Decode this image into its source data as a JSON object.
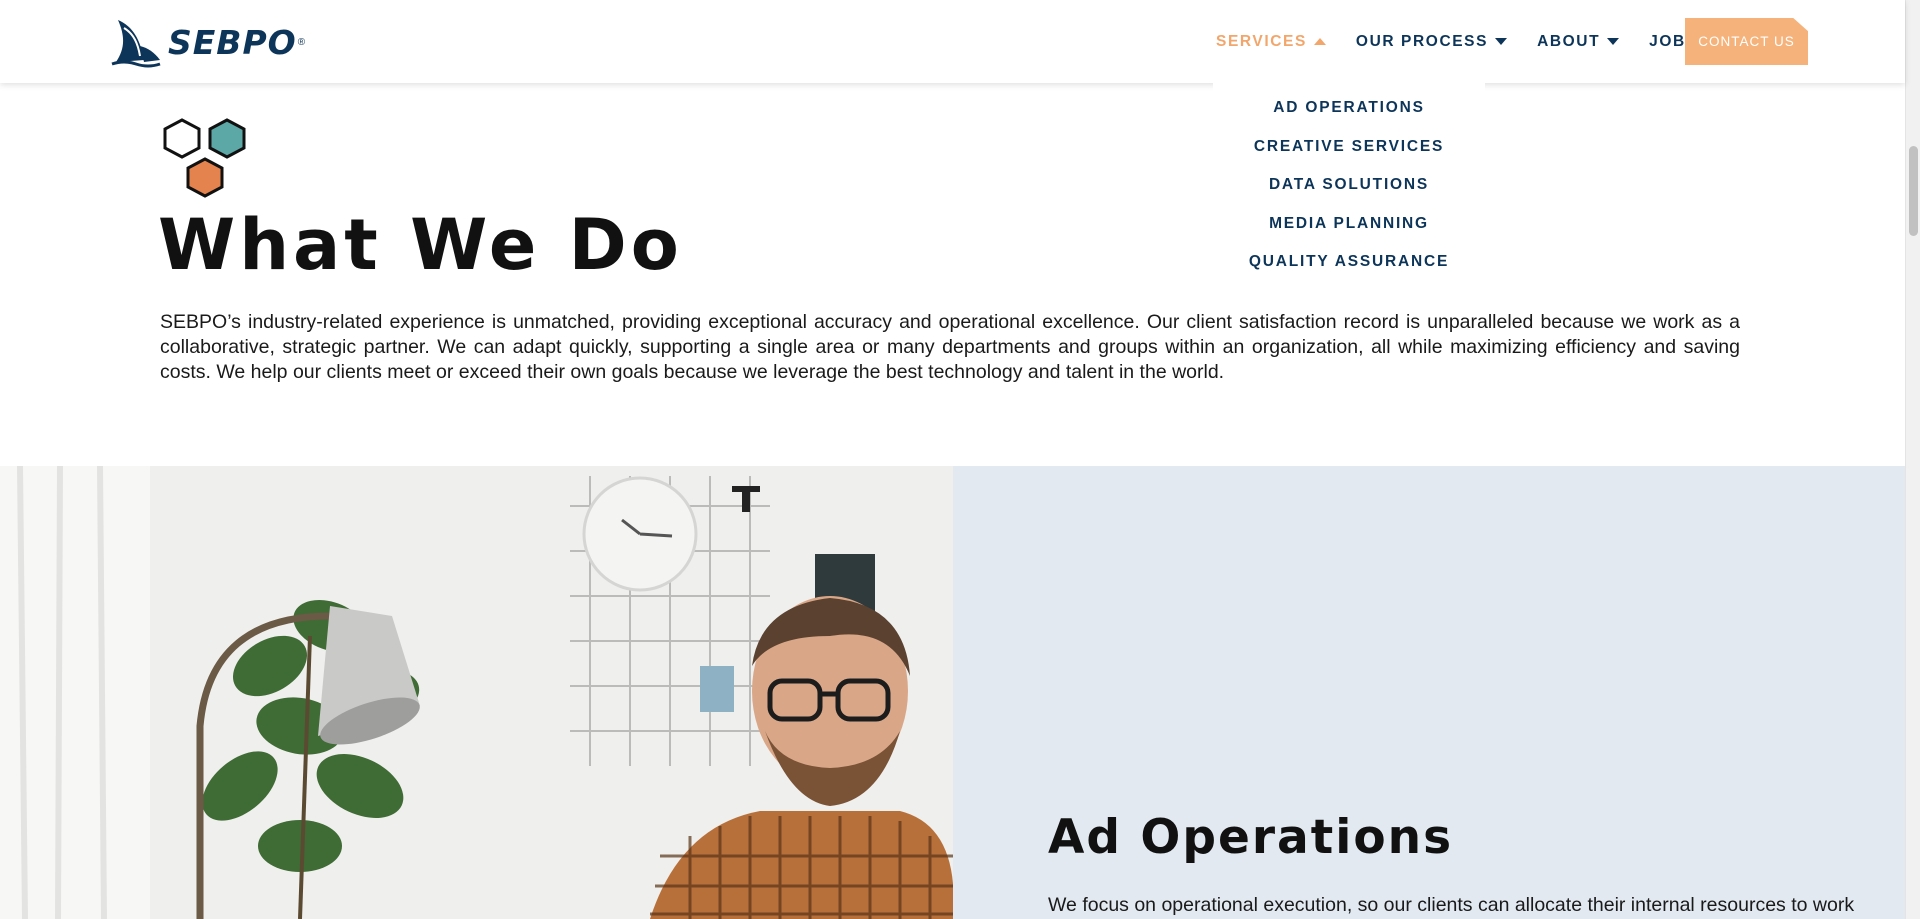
{
  "header": {
    "logo_text": "SEBPO",
    "logo_reg": "®",
    "nav": [
      {
        "label": "SERVICES",
        "state": "active-open"
      },
      {
        "label": "OUR PROCESS",
        "state": "dropdown"
      },
      {
        "label": "ABOUT",
        "state": "dropdown"
      },
      {
        "label": "JOBS",
        "state": "plain"
      }
    ],
    "contact_label": "CONTACT US"
  },
  "services_menu": {
    "items": [
      "AD OPERATIONS",
      "CREATIVE SERVICES",
      "DATA SOLUTIONS",
      "MEDIA PLANNING",
      "QUALITY ASSURANCE"
    ]
  },
  "intro": {
    "title": "What We Do",
    "body": "SEBPO’s industry-related experience is unmatched, providing exceptional accuracy and operational excellence. Our client satisfaction record is unparalleled because we work as a collaborative, strategic partner. We can adapt quickly, supporting a single area or many departments and groups within an organization, all while maximizing efficiency and saving costs. We help our clients meet or exceed their own goals because we leverage the best technology and talent in the world."
  },
  "service": {
    "title": "Ad Operations",
    "body": "We focus on operational execution, so our clients can allocate their internal resources to work"
  },
  "colors": {
    "brand_navy": "#0d3559",
    "accent_orange": "#f2a66b",
    "button_orange": "#f5b27a",
    "hex_teal": "#5ba8a6",
    "hex_orange": "#e5834f",
    "panel_bg": "#e2e9f1"
  },
  "icons": [
    "sebpo-ship-logo-icon",
    "hexagon-cluster-icon",
    "caret-up-icon",
    "caret-down-icon"
  ]
}
